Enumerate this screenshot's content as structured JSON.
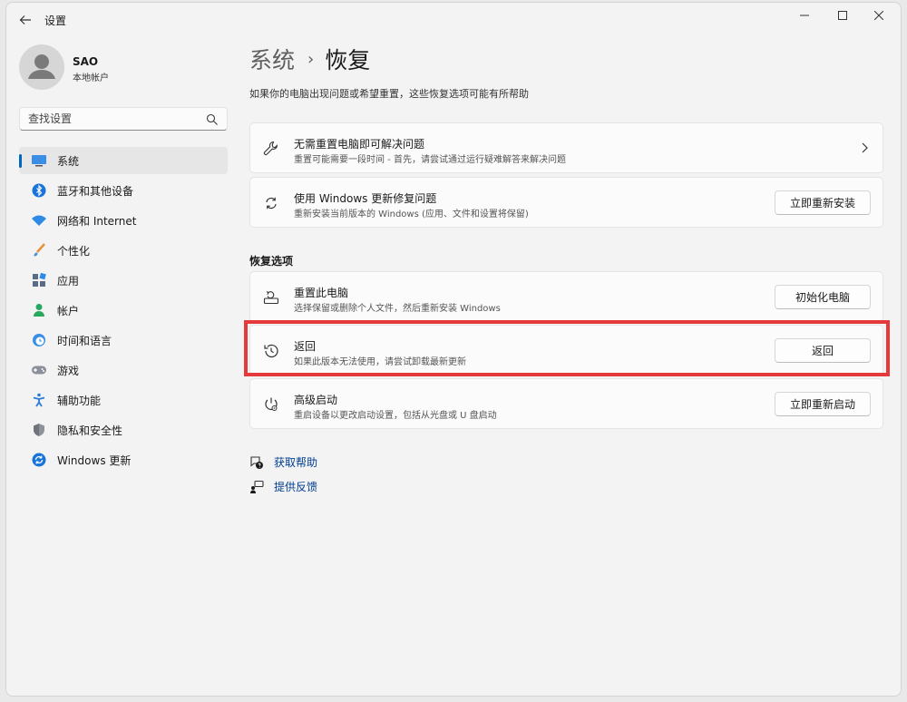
{
  "window": {
    "title": "设置"
  },
  "user": {
    "name": "SAO",
    "account_type": "本地帐户"
  },
  "search": {
    "placeholder": "查找设置"
  },
  "sidebar": {
    "items": [
      {
        "label": "系统",
        "icon": "system-icon",
        "active": true
      },
      {
        "label": "蓝牙和其他设备",
        "icon": "bluetooth-icon"
      },
      {
        "label": "网络和 Internet",
        "icon": "wifi-icon"
      },
      {
        "label": "个性化",
        "icon": "paintbrush-icon"
      },
      {
        "label": "应用",
        "icon": "apps-icon"
      },
      {
        "label": "帐户",
        "icon": "account-icon"
      },
      {
        "label": "时间和语言",
        "icon": "time-language-icon"
      },
      {
        "label": "游戏",
        "icon": "gamepad-icon"
      },
      {
        "label": "辅助功能",
        "icon": "accessibility-icon"
      },
      {
        "label": "隐私和安全性",
        "icon": "shield-icon"
      },
      {
        "label": "Windows 更新",
        "icon": "windows-update-icon"
      }
    ]
  },
  "breadcrumb": {
    "parent": "系统",
    "separator": "›",
    "current": "恢复"
  },
  "page": {
    "description": "如果你的电脑出现问题或希望重置，这些恢复选项可能有所帮助"
  },
  "cards": {
    "troubleshoot": {
      "title": "无需重置电脑即可解决问题",
      "subtitle": "重置可能需要一段时间 - 首先，请尝试通过运行疑难解答来解决问题",
      "icon": "wrench-icon"
    },
    "windows_update_fix": {
      "title": "使用 Windows 更新修复问题",
      "subtitle": "重新安装当前版本的 Windows (应用、文件和设置将保留)",
      "button": "立即重新安装",
      "icon": "sync-icon"
    }
  },
  "recovery_options": {
    "section_title": "恢复选项",
    "reset_pc": {
      "title": "重置此电脑",
      "subtitle": "选择保留或删除个人文件，然后重新安装 Windows",
      "button": "初始化电脑",
      "icon": "reset-pc-icon"
    },
    "go_back": {
      "title": "返回",
      "subtitle": "如果此版本无法使用，请尝试卸载最新更新",
      "button": "返回",
      "icon": "history-icon"
    },
    "advanced_startup": {
      "title": "高级启动",
      "subtitle": "重启设备以更改启动设置，包括从光盘或 U 盘启动",
      "button": "立即重新启动",
      "icon": "advanced-startup-icon"
    }
  },
  "links": {
    "get_help": "获取帮助",
    "give_feedback": "提供反馈"
  },
  "colors": {
    "accent": "#0067c0",
    "highlight_border": "#e5393b",
    "link": "#003e92"
  }
}
